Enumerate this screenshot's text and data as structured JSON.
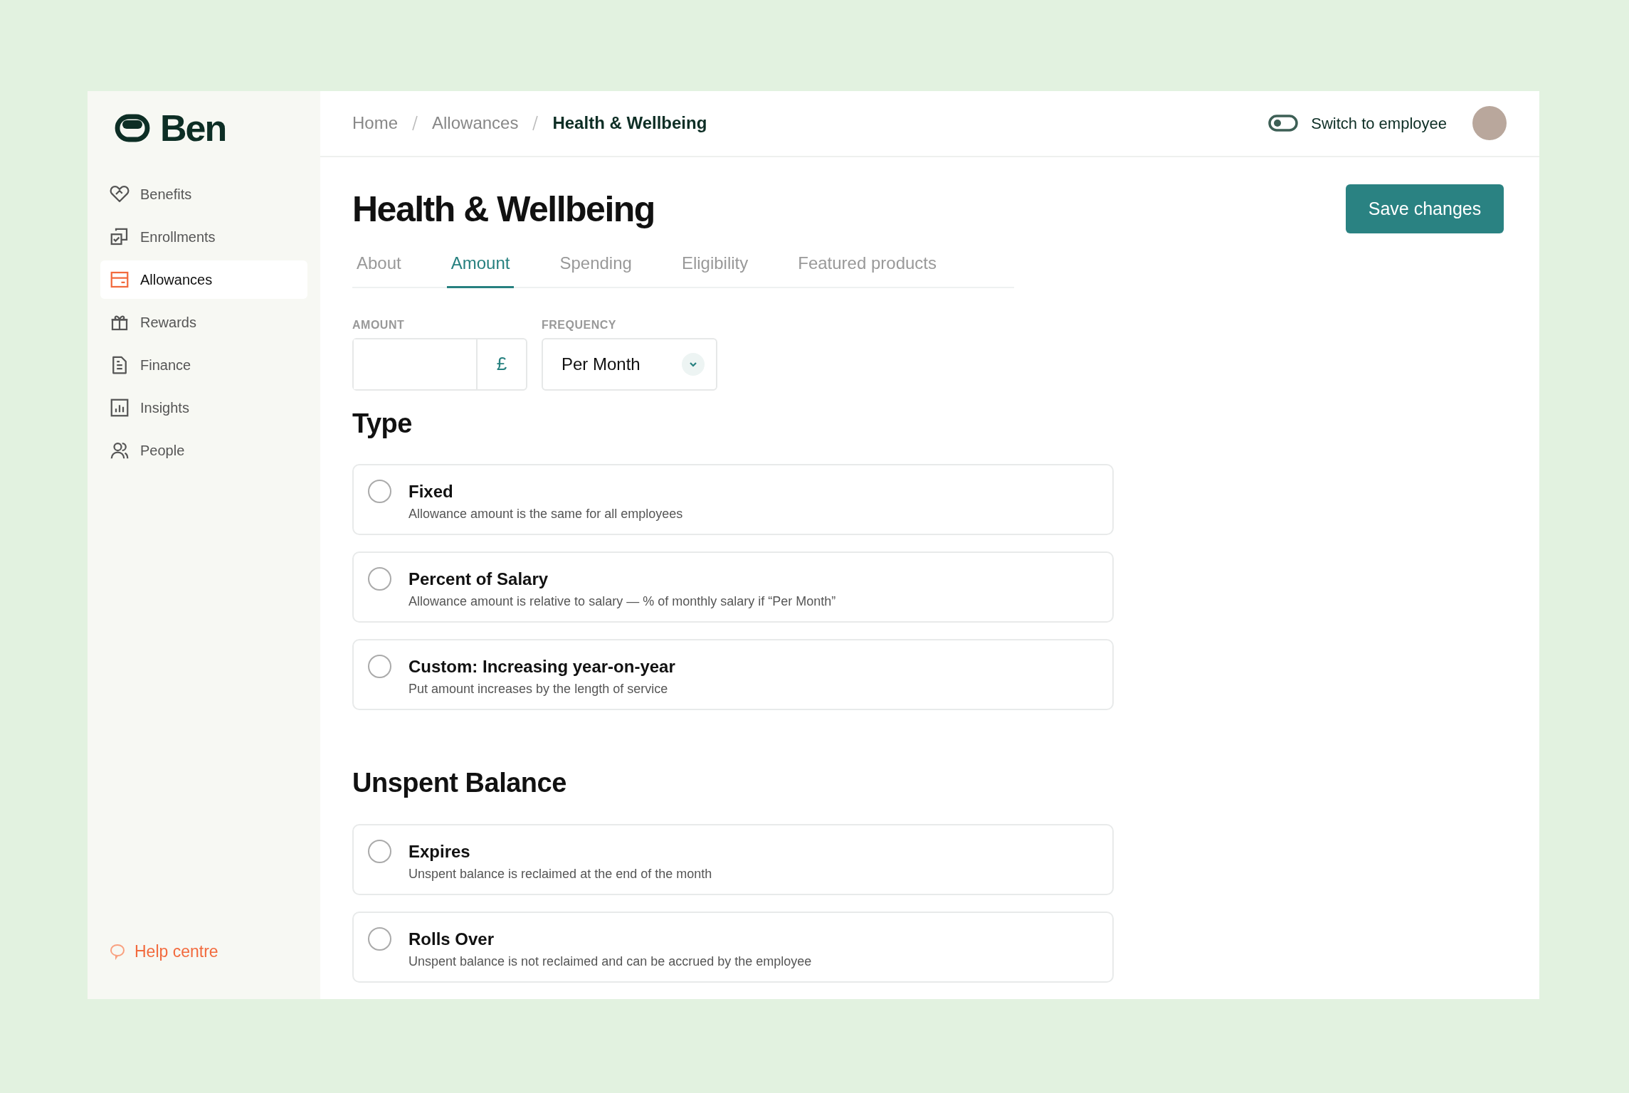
{
  "sidebar": {
    "logo": "Ben",
    "items": [
      {
        "label": "Benefits",
        "selected": false
      },
      {
        "label": "Enrollments",
        "selected": false
      },
      {
        "label": "Allowances",
        "selected": true
      },
      {
        "label": "Rewards",
        "selected": false
      },
      {
        "label": "Finance",
        "selected": false
      },
      {
        "label": "Insights",
        "selected": false
      },
      {
        "label": "People",
        "selected": false
      }
    ],
    "help": "Help centre"
  },
  "breadcrumb": [
    {
      "label": "Home",
      "current": false
    },
    {
      "label": "Allowances",
      "current": false
    },
    {
      "label": "Health & Wellbeing",
      "current": true
    }
  ],
  "header": {
    "switch": {
      "label": "Switch to employee",
      "on": false
    }
  },
  "page": {
    "title": "Health & Wellbeing",
    "save_button": "Save changes",
    "tabs": [
      {
        "label": "About",
        "selected": false
      },
      {
        "label": "Amount",
        "selected": true
      },
      {
        "label": "Spending",
        "selected": false
      },
      {
        "label": "Eligibility",
        "selected": false
      },
      {
        "label": "Featured products",
        "selected": false
      }
    ],
    "amount": {
      "label": "AMOUNT",
      "currency": "£"
    },
    "frequency": {
      "label": "FREQUENCY",
      "value": "Per Month"
    },
    "sections": [
      {
        "heading": "Type",
        "options": [
          {
            "title": "Fixed",
            "description": "Allowance amount is the same for all employees",
            "selected": false
          },
          {
            "title": "Percent of Salary",
            "description": "Allowance amount is relative to salary — % of monthly salary if “Per Month”",
            "selected": false
          },
          {
            "title": "Custom: Increasing year-on-year",
            "description": "Put amount increases by the length of service",
            "selected": false
          }
        ]
      },
      {
        "heading": "Unspent Balance",
        "options": [
          {
            "title": "Expires",
            "description": "Unspent balance is reclaimed at the end of the month",
            "selected": false
          },
          {
            "title": "Rolls Over",
            "description": "Unspent balance is not reclaimed and can be accrued by the employee",
            "selected": false
          }
        ]
      }
    ]
  }
}
